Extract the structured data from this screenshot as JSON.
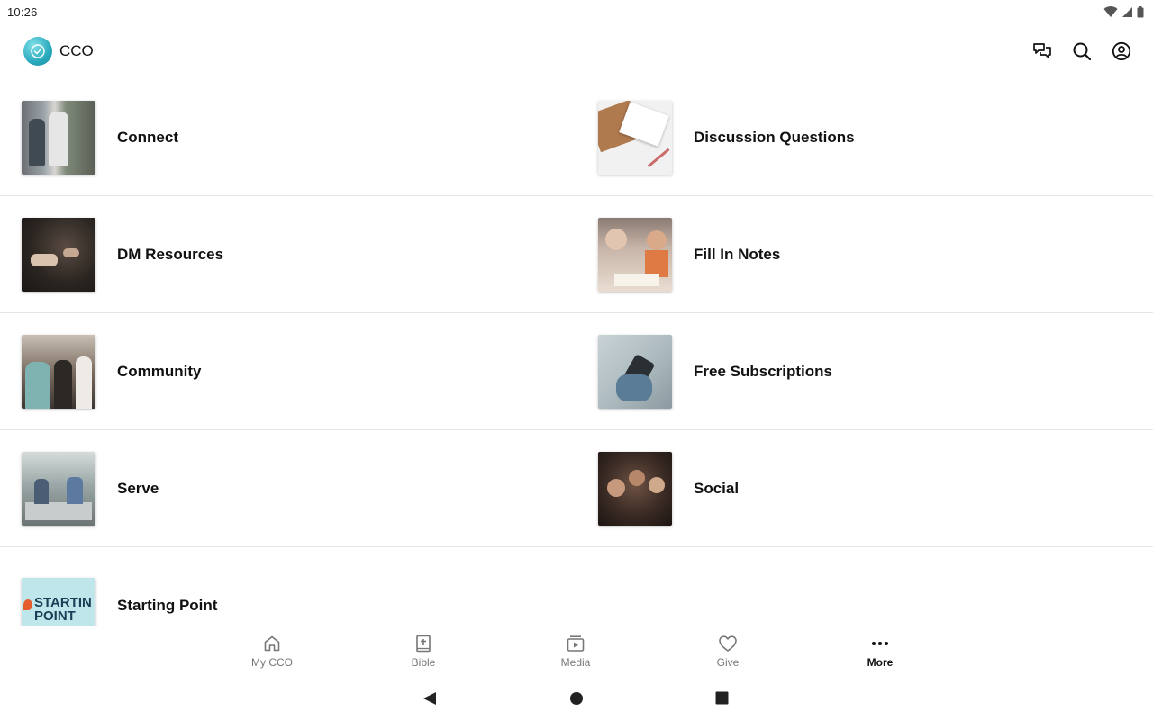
{
  "status": {
    "time": "10:26"
  },
  "app": {
    "title": "CCO"
  },
  "tiles": [
    {
      "label": "Connect"
    },
    {
      "label": "Discussion Questions"
    },
    {
      "label": "DM Resources"
    },
    {
      "label": "Fill In Notes"
    },
    {
      "label": "Community"
    },
    {
      "label": "Free Subscriptions"
    },
    {
      "label": "Serve"
    },
    {
      "label": "Social"
    },
    {
      "label": "Starting Point",
      "thumb_text": "STARTIN POINT"
    }
  ],
  "nav": {
    "items": [
      {
        "label": "My CCO",
        "icon": "home-icon"
      },
      {
        "label": "Bible",
        "icon": "bible-icon"
      },
      {
        "label": "Media",
        "icon": "media-icon"
      },
      {
        "label": "Give",
        "icon": "heart-icon"
      },
      {
        "label": "More",
        "icon": "more-icon",
        "active": true
      }
    ]
  },
  "colors": {
    "accent": "#2aa9bd",
    "divider": "#e6e6e6",
    "inactive": "#777777"
  }
}
